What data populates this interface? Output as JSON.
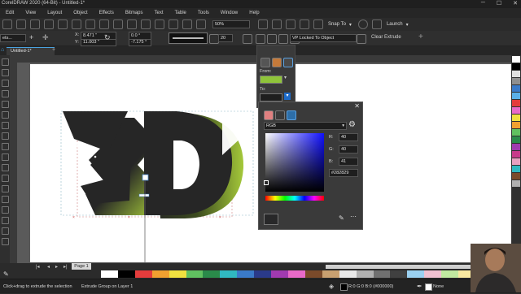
{
  "title": "CorelDRAW 2020 (64-Bit) - Untitled-1*",
  "window_buttons": [
    "─",
    "☐",
    "✕"
  ],
  "menu": [
    "Edit",
    "View",
    "Layout",
    "Object",
    "Effects",
    "Bitmaps",
    "Text",
    "Table",
    "Tools",
    "Window",
    "Help"
  ],
  "toolbar": {
    "zoom": "50%",
    "snap_to": "Snap To",
    "launch": "Launch"
  },
  "propbar": {
    "preset": "ets...",
    "x": "8.471 \"",
    "y": "11.003 \"",
    "rot_x": "0.0 °",
    "rot_y": "-7.175 °",
    "depth": "20",
    "vp_mode": "VP Locked To Object",
    "clear": "Clear Extrude"
  },
  "tab": "Untitled-1*",
  "page_tab": "Page 1",
  "docker": {
    "from_label": "From:",
    "to_label": "To:",
    "from_color": "#8fc43a",
    "to_color": "#1e4fa8"
  },
  "picker": {
    "model": "RGB",
    "r_label": "R:",
    "g_label": "G:",
    "b_label": "B:",
    "r": "40",
    "g": "40",
    "b": "41",
    "hex": "#282829",
    "swatch": "#282829"
  },
  "artwork": {
    "text": "3D",
    "face_color": "#262626",
    "glow_color": "#a5c93a"
  },
  "status": {
    "hint": "Click+drag to extrude the selection",
    "object": "Extrude Group on Layer 1",
    "fill": "R:0 G:0 B:0 (#000000)",
    "outline": "None"
  }
}
